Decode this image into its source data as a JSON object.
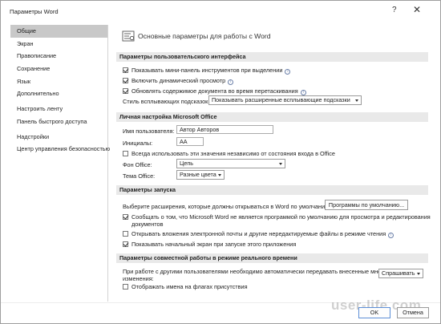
{
  "window": {
    "title": "Параметры Word",
    "help": "?",
    "close": "✕"
  },
  "sidebar": {
    "items": [
      {
        "label": "Общие",
        "active": true
      },
      {
        "label": "Экран"
      },
      {
        "label": "Правописание"
      },
      {
        "label": "Сохранение"
      },
      {
        "label": "Язык"
      },
      {
        "label": "Дополнительно"
      },
      {
        "label": "Настроить ленту"
      },
      {
        "label": "Панель быстрого доступа"
      },
      {
        "label": "Надстройки"
      },
      {
        "label": "Центр управления безопасностью"
      }
    ]
  },
  "main": {
    "header": "Основные параметры для работы с Word",
    "ui_section": {
      "title": "Параметры пользовательского интерфейса",
      "mini_toolbar": {
        "label": "Показывать мини-панель инструментов при выделении",
        "checked": true
      },
      "live_preview": {
        "label": "Включить динамический просмотр",
        "checked": true
      },
      "update_drag": {
        "label": "Обновлять содержимое документа во время перетаскивания",
        "checked": true
      },
      "tooltip_style": {
        "label": "Стиль всплывающих подсказок:",
        "value": "Показывать расширенные всплывающие подсказки"
      }
    },
    "personal_section": {
      "title": "Личная настройка Microsoft Office",
      "username": {
        "label": "Имя пользователя:",
        "value": "Автор Авторов"
      },
      "initials": {
        "label": "Инициалы:",
        "value": "АА"
      },
      "always_use": {
        "label": "Всегда использовать эти значения независимо от состояния входа в Office",
        "checked": false
      },
      "background": {
        "label": "Фон Office:",
        "value": "Цепь"
      },
      "theme": {
        "label": "Тема Office:",
        "value": "Разные цвета"
      }
    },
    "startup_section": {
      "title": "Параметры запуска",
      "choose_ext": {
        "label": "Выберите расширения, которые должны открываться в Word по умолчанию:",
        "button": "Программы по умолчанию..."
      },
      "notify_default": {
        "label_line1": "Сообщать о том, что Microsoft Word не является программой по умолчанию для просмотра и редактирования",
        "label_line2": "документов",
        "checked": true
      },
      "open_email": {
        "label": "Открывать вложения электронной почты и другие нередактируемые файлы в режиме чтения",
        "checked": false
      },
      "show_start": {
        "label": "Показывать начальный экран при запуске этого приложения",
        "checked": true
      }
    },
    "collab_section": {
      "title": "Параметры совместной работы в режиме реального времени",
      "share_changes": {
        "label_line1": "При работе с другими пользователями необходимо автоматически передавать внесенные мной",
        "label_line2": "изменения:",
        "value": "Спрашивать"
      },
      "show_names": {
        "label": "Отображать имена на флагах присутствия",
        "checked": false
      }
    }
  },
  "footer": {
    "ok": "OK",
    "cancel": "Отмена"
  },
  "watermark": "user-life.com",
  "colors": {
    "active_sidebar": "#c8c8c8",
    "section_bg": "#e9e9e9",
    "primary_border": "#5c8ed6"
  }
}
